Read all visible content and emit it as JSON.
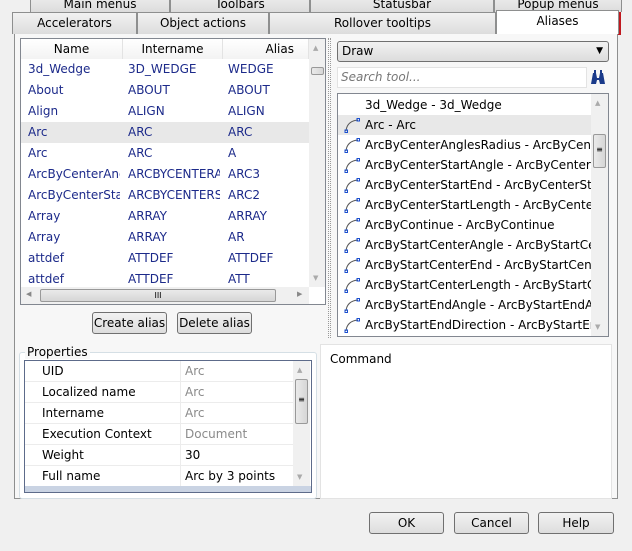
{
  "tabs_row1": [
    {
      "label": "Main menus"
    },
    {
      "label": "Toolbars"
    },
    {
      "label": "Statusbar"
    },
    {
      "label": "Popup menus"
    }
  ],
  "tabs_row2": [
    {
      "label": "Accelerators"
    },
    {
      "label": "Object actions"
    },
    {
      "label": "Rollover tooltips"
    },
    {
      "label": "Aliases",
      "active": true
    }
  ],
  "highlight_color": "#c0191f",
  "alias_table": {
    "columns": [
      "Name",
      "Intername",
      "Alias"
    ],
    "rows": [
      {
        "name": "3d_Wedge",
        "intername": "3D_WEDGE",
        "alias": "WEDGE"
      },
      {
        "name": "About",
        "intername": "ABOUT",
        "alias": "ABOUT"
      },
      {
        "name": "Align",
        "intername": "ALIGN",
        "alias": "ALIGN"
      },
      {
        "name": "Arc",
        "intername": "ARC",
        "alias": "ARC",
        "selected": true
      },
      {
        "name": "Arc",
        "intername": "ARC",
        "alias": "A"
      },
      {
        "name": "ArcByCenterAngl",
        "intername": "ARCBYCENTERAI",
        "alias": "ARC3"
      },
      {
        "name": "ArcByCenterStart",
        "intername": "ARCBYCENTERST",
        "alias": "ARC2"
      },
      {
        "name": "Array",
        "intername": "ARRAY",
        "alias": "ARRAY"
      },
      {
        "name": "Array",
        "intername": "ARRAY",
        "alias": "AR"
      },
      {
        "name": "attdef",
        "intername": "ATTDEF",
        "alias": "ATTDEF"
      },
      {
        "name": "attdef",
        "intername": "ATTDEF",
        "alias": "ATT"
      }
    ],
    "hscroll_grip": "III"
  },
  "buttons": {
    "create_alias": "Create alias",
    "delete_alias": "Delete alias",
    "ok": "OK",
    "cancel": "Cancel",
    "help": "Help"
  },
  "category_select": {
    "value": "Draw"
  },
  "search": {
    "placeholder": "Search tool..."
  },
  "tools": [
    {
      "label": "3d_Wedge - 3d_Wedge",
      "icon": "none"
    },
    {
      "label": "Arc - Arc",
      "icon": "arc-icon",
      "selected": true
    },
    {
      "label": "ArcByCenterAnglesRadius - ArcByCente",
      "icon": "arc-center-angles-radius-icon"
    },
    {
      "label": "ArcByCenterStartAngle - ArcByCenterSt",
      "icon": "arc-center-start-angle-icon"
    },
    {
      "label": "ArcByCenterStartEnd - ArcByCenterStar",
      "icon": "arc-center-start-end-icon"
    },
    {
      "label": "ArcByCenterStartLength - ArcByCenterS",
      "icon": "arc-center-start-length-icon"
    },
    {
      "label": "ArcByContinue - ArcByContinue",
      "icon": "arc-continue-icon"
    },
    {
      "label": "ArcByStartCenterAngle - ArcByStartCen",
      "icon": "arc-start-center-angle-icon"
    },
    {
      "label": "ArcByStartCenterEnd - ArcByStartCente",
      "icon": "arc-start-center-end-icon"
    },
    {
      "label": "ArcByStartCenterLength - ArcByStartCe",
      "icon": "arc-start-center-length-icon"
    },
    {
      "label": "ArcByStartEndAngle - ArcByStartEndAn",
      "icon": "arc-start-end-angle-icon"
    },
    {
      "label": "ArcByStartEndDirection - ArcByStartEnc",
      "icon": "arc-start-end-direction-icon"
    }
  ],
  "properties": {
    "title": "Properties",
    "rows": [
      {
        "key": "UID",
        "value": "Arc",
        "readonly": true
      },
      {
        "key": "Localized name",
        "value": "Arc",
        "readonly": true
      },
      {
        "key": "Intername",
        "value": "Arc",
        "readonly": true
      },
      {
        "key": "Execution Context",
        "value": "Document",
        "readonly": true
      },
      {
        "key": "Weight",
        "value": "30",
        "readonly": false
      },
      {
        "key": "Full name",
        "value": "Arc by 3 points",
        "readonly": false
      }
    ]
  },
  "command": {
    "label": "Command"
  }
}
